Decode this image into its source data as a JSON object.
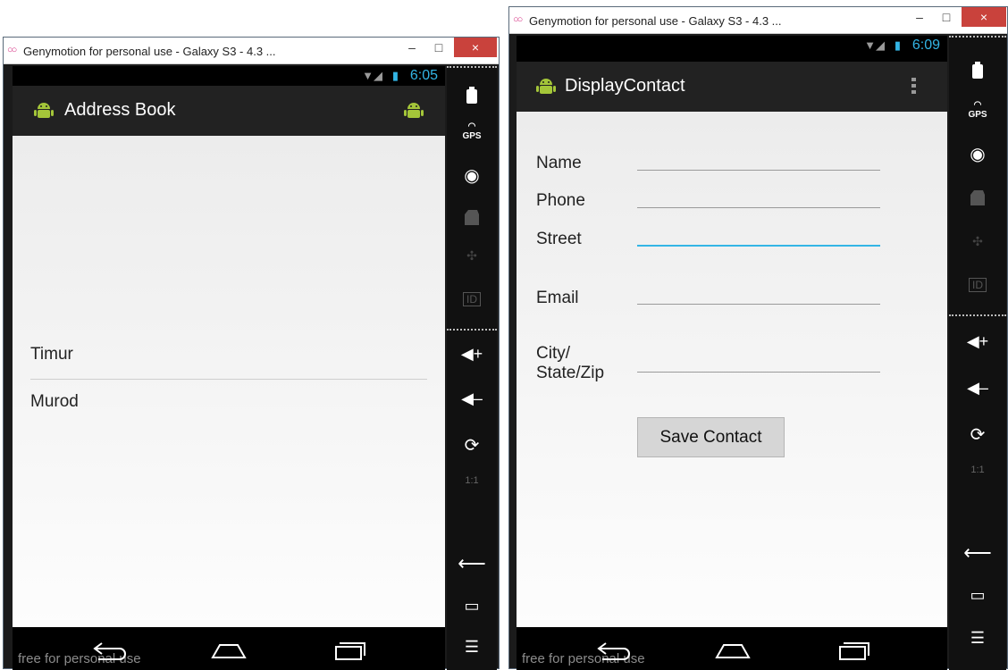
{
  "window_left": {
    "title": "Genymotion for personal use - Galaxy S3 - 4.3 ...",
    "clock": "6:05",
    "app_title": "Address Book",
    "contacts": [
      "Timur",
      "Murod"
    ],
    "watermark": "free for personal use"
  },
  "window_right": {
    "title": "Genymotion for personal use - Galaxy S3 - 4.3 ...",
    "clock": "6:09",
    "app_title": "DisplayContact",
    "fields": {
      "name_label": "Name",
      "phone_label": "Phone",
      "street_label": "Street",
      "email_label": "Email",
      "city_label_line1": "City/",
      "city_label_line2": "State/Zip",
      "name_value": "",
      "phone_value": "",
      "street_value": "",
      "email_value": "",
      "city_value": ""
    },
    "save_label": "Save Contact",
    "watermark": "free for personal use"
  },
  "window_buttons": {
    "minimize": "–",
    "maximize": "□",
    "close": "×"
  },
  "sidebar": {
    "gps_label": "GPS",
    "id_label": "ID",
    "scale_label": "1:1"
  },
  "icons": [
    "battery-icon",
    "gps-icon",
    "webcam-icon",
    "camera-icon",
    "dpad-icon",
    "id-icon",
    "volume-up-icon",
    "volume-down-icon",
    "rotate-icon",
    "scale-icon",
    "back-icon",
    "home-icon",
    "recents-icon",
    "menu-icon",
    "android-icon",
    "overflow-menu-icon",
    "wifi-icon"
  ],
  "colors": {
    "accent": "#33b5e5",
    "close_button": "#c9423c",
    "action_bar": "#222222",
    "android_green": "#a4c639"
  }
}
